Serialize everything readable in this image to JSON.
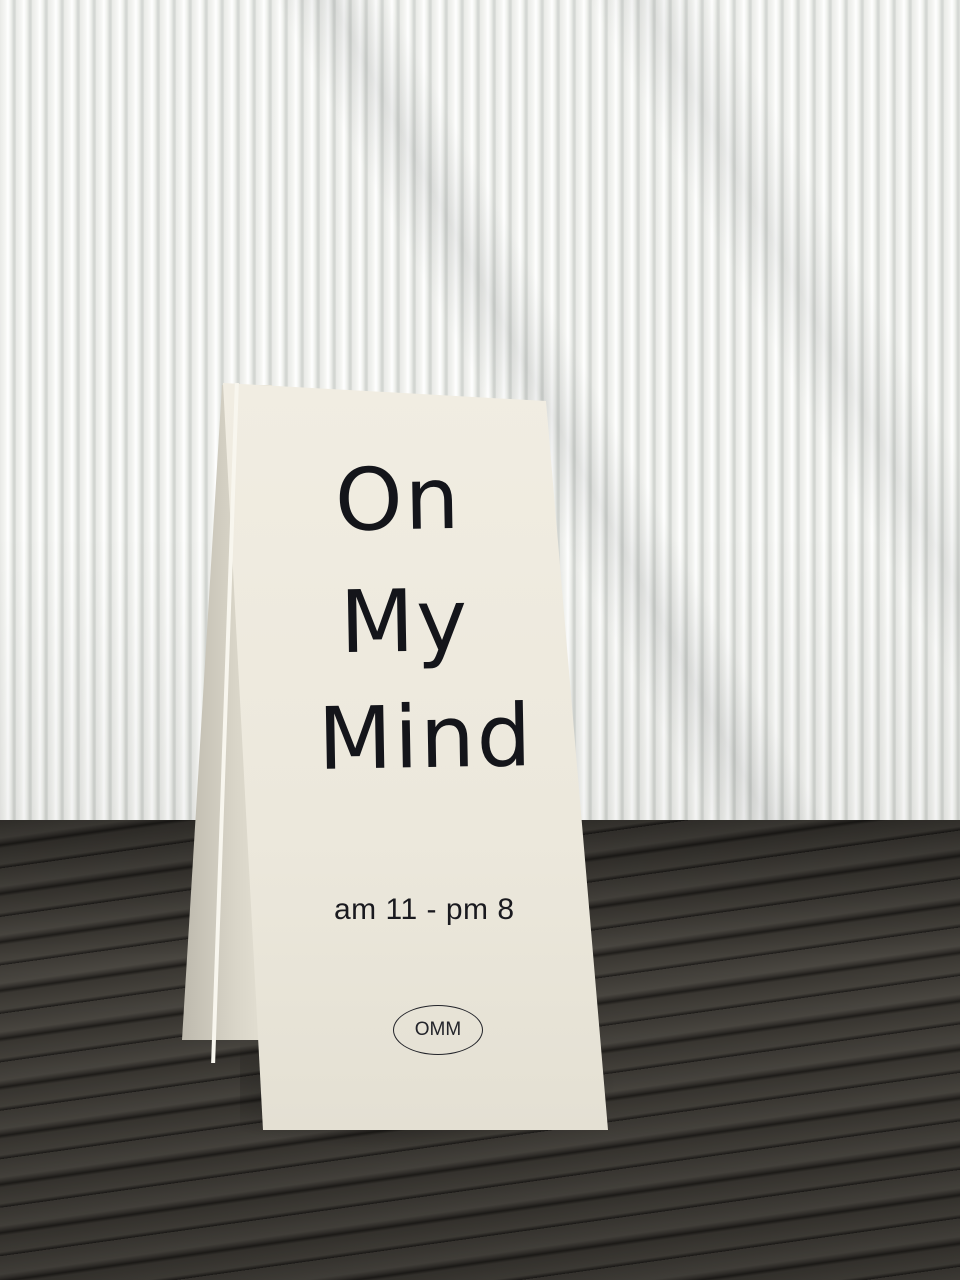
{
  "sign": {
    "title_line1": "On",
    "title_line2": "My",
    "title_line3": "Mind",
    "hours": "am 11 - pm 8",
    "logo_text": "OMM"
  },
  "colors": {
    "wall": "#eef0ec",
    "deck": "#3a3733",
    "sign_face": "#ece8dc",
    "ink": "#14151a"
  }
}
